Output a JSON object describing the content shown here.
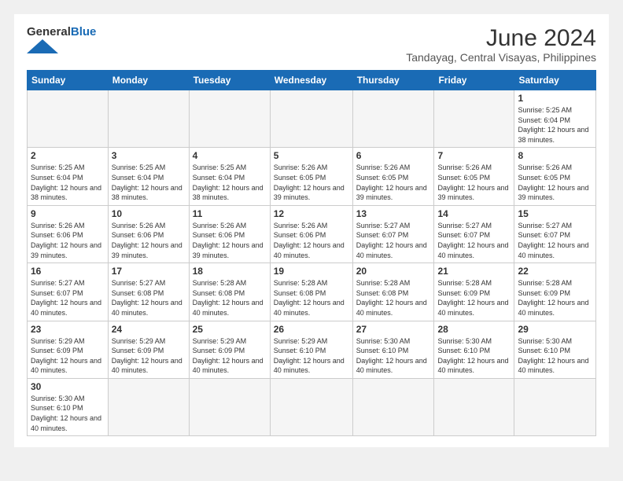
{
  "logo": {
    "general": "General",
    "blue": "Blue"
  },
  "header": {
    "month_year": "June 2024",
    "location": "Tandayag, Central Visayas, Philippines"
  },
  "days_of_week": [
    "Sunday",
    "Monday",
    "Tuesday",
    "Wednesday",
    "Thursday",
    "Friday",
    "Saturday"
  ],
  "weeks": [
    [
      {
        "day": "",
        "info": ""
      },
      {
        "day": "",
        "info": ""
      },
      {
        "day": "",
        "info": ""
      },
      {
        "day": "",
        "info": ""
      },
      {
        "day": "",
        "info": ""
      },
      {
        "day": "",
        "info": ""
      },
      {
        "day": "1",
        "info": "Sunrise: 5:25 AM\nSunset: 6:04 PM\nDaylight: 12 hours\nand 38 minutes."
      }
    ],
    [
      {
        "day": "2",
        "info": "Sunrise: 5:25 AM\nSunset: 6:04 PM\nDaylight: 12 hours\nand 38 minutes."
      },
      {
        "day": "3",
        "info": "Sunrise: 5:25 AM\nSunset: 6:04 PM\nDaylight: 12 hours\nand 38 minutes."
      },
      {
        "day": "4",
        "info": "Sunrise: 5:25 AM\nSunset: 6:04 PM\nDaylight: 12 hours\nand 38 minutes."
      },
      {
        "day": "5",
        "info": "Sunrise: 5:26 AM\nSunset: 6:05 PM\nDaylight: 12 hours\nand 39 minutes."
      },
      {
        "day": "6",
        "info": "Sunrise: 5:26 AM\nSunset: 6:05 PM\nDaylight: 12 hours\nand 39 minutes."
      },
      {
        "day": "7",
        "info": "Sunrise: 5:26 AM\nSunset: 6:05 PM\nDaylight: 12 hours\nand 39 minutes."
      },
      {
        "day": "8",
        "info": "Sunrise: 5:26 AM\nSunset: 6:05 PM\nDaylight: 12 hours\nand 39 minutes."
      }
    ],
    [
      {
        "day": "9",
        "info": "Sunrise: 5:26 AM\nSunset: 6:06 PM\nDaylight: 12 hours\nand 39 minutes."
      },
      {
        "day": "10",
        "info": "Sunrise: 5:26 AM\nSunset: 6:06 PM\nDaylight: 12 hours\nand 39 minutes."
      },
      {
        "day": "11",
        "info": "Sunrise: 5:26 AM\nSunset: 6:06 PM\nDaylight: 12 hours\nand 39 minutes."
      },
      {
        "day": "12",
        "info": "Sunrise: 5:26 AM\nSunset: 6:06 PM\nDaylight: 12 hours\nand 40 minutes."
      },
      {
        "day": "13",
        "info": "Sunrise: 5:27 AM\nSunset: 6:07 PM\nDaylight: 12 hours\nand 40 minutes."
      },
      {
        "day": "14",
        "info": "Sunrise: 5:27 AM\nSunset: 6:07 PM\nDaylight: 12 hours\nand 40 minutes."
      },
      {
        "day": "15",
        "info": "Sunrise: 5:27 AM\nSunset: 6:07 PM\nDaylight: 12 hours\nand 40 minutes."
      }
    ],
    [
      {
        "day": "16",
        "info": "Sunrise: 5:27 AM\nSunset: 6:07 PM\nDaylight: 12 hours\nand 40 minutes."
      },
      {
        "day": "17",
        "info": "Sunrise: 5:27 AM\nSunset: 6:08 PM\nDaylight: 12 hours\nand 40 minutes."
      },
      {
        "day": "18",
        "info": "Sunrise: 5:28 AM\nSunset: 6:08 PM\nDaylight: 12 hours\nand 40 minutes."
      },
      {
        "day": "19",
        "info": "Sunrise: 5:28 AM\nSunset: 6:08 PM\nDaylight: 12 hours\nand 40 minutes."
      },
      {
        "day": "20",
        "info": "Sunrise: 5:28 AM\nSunset: 6:08 PM\nDaylight: 12 hours\nand 40 minutes."
      },
      {
        "day": "21",
        "info": "Sunrise: 5:28 AM\nSunset: 6:09 PM\nDaylight: 12 hours\nand 40 minutes."
      },
      {
        "day": "22",
        "info": "Sunrise: 5:28 AM\nSunset: 6:09 PM\nDaylight: 12 hours\nand 40 minutes."
      }
    ],
    [
      {
        "day": "23",
        "info": "Sunrise: 5:29 AM\nSunset: 6:09 PM\nDaylight: 12 hours\nand 40 minutes."
      },
      {
        "day": "24",
        "info": "Sunrise: 5:29 AM\nSunset: 6:09 PM\nDaylight: 12 hours\nand 40 minutes."
      },
      {
        "day": "25",
        "info": "Sunrise: 5:29 AM\nSunset: 6:09 PM\nDaylight: 12 hours\nand 40 minutes."
      },
      {
        "day": "26",
        "info": "Sunrise: 5:29 AM\nSunset: 6:10 PM\nDaylight: 12 hours\nand 40 minutes."
      },
      {
        "day": "27",
        "info": "Sunrise: 5:30 AM\nSunset: 6:10 PM\nDaylight: 12 hours\nand 40 minutes."
      },
      {
        "day": "28",
        "info": "Sunrise: 5:30 AM\nSunset: 6:10 PM\nDaylight: 12 hours\nand 40 minutes."
      },
      {
        "day": "29",
        "info": "Sunrise: 5:30 AM\nSunset: 6:10 PM\nDaylight: 12 hours\nand 40 minutes."
      }
    ],
    [
      {
        "day": "30",
        "info": "Sunrise: 5:30 AM\nSunset: 6:10 PM\nDaylight: 12 hours\nand 40 minutes."
      },
      {
        "day": "",
        "info": ""
      },
      {
        "day": "",
        "info": ""
      },
      {
        "day": "",
        "info": ""
      },
      {
        "day": "",
        "info": ""
      },
      {
        "day": "",
        "info": ""
      },
      {
        "day": "",
        "info": ""
      }
    ]
  ]
}
